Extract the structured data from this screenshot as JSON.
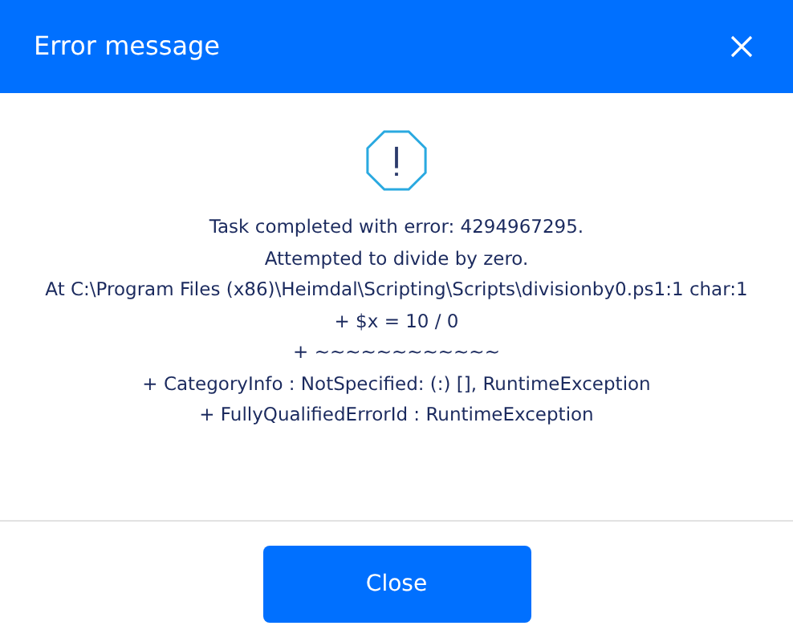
{
  "dialog": {
    "title": "Error message",
    "message_lines": [
      "Task completed with error: 4294967295.",
      "Attempted to divide by zero.",
      "At C:\\Program Files (x86)\\Heimdal\\Scripting\\Scripts\\divisionby0.ps1:1 char:1",
      "+ $x = 10 / 0",
      "+ ~~~~~~~~~~~~",
      "+ CategoryInfo : NotSpecified: (:) [], RuntimeException",
      "+ FullyQualifiedErrorId : RuntimeException"
    ],
    "buttons": [
      "Close"
    ]
  }
}
